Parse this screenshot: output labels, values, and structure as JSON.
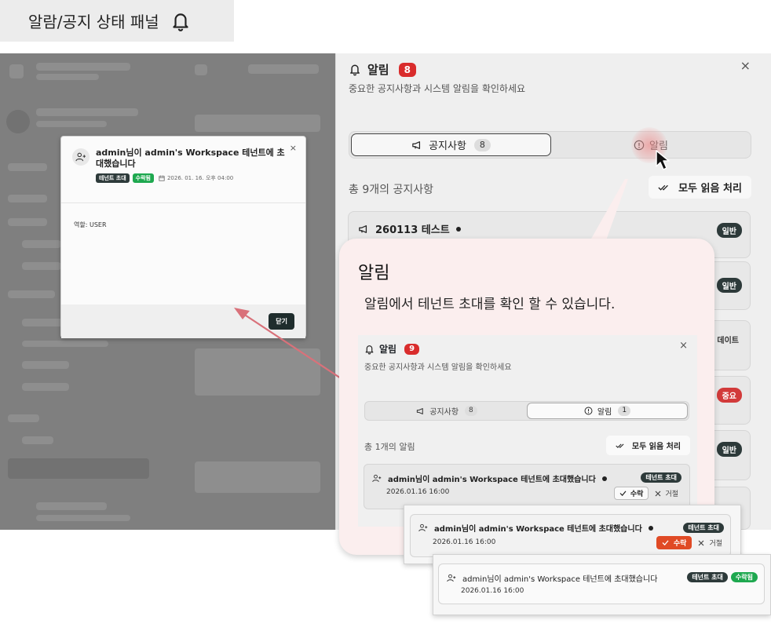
{
  "page_label": {
    "text": "알람/공지 상태 패널"
  },
  "panel": {
    "title": "알림",
    "badge": "8",
    "close": "×",
    "subtitle": "중요한 공지사항과 시스템 알림을 확인하세요",
    "tabs": [
      {
        "label": "공지사항",
        "count": "8"
      },
      {
        "label": "알림"
      }
    ],
    "total": "총 9개의 공지사항",
    "mark_all": "모두 읽음 처리",
    "notices": [
      {
        "title": "260113 테스트",
        "tag": "일반"
      },
      {
        "tag": "일반"
      },
      {
        "partial": "데이트"
      },
      {
        "tag": "중요"
      },
      {
        "tag": "일반"
      }
    ]
  },
  "modal": {
    "title": "admin님이 admin's Workspace 테넌트에 초대했습니다",
    "close": "×",
    "tag_type": "테넌트 초대",
    "tag_status": "수락됨",
    "date": "2026. 01. 16. 오후 04:00",
    "body": "역할: USER",
    "button": "닫기"
  },
  "callout": {
    "title": "알림",
    "description": "알림에서 테넌트 초대를 확인 할 수 있습니다.",
    "mini": {
      "title": "알림",
      "badge": "9",
      "close": "×",
      "subtitle": "중요한 공지사항과 시스템 알림을 확인하세요",
      "tabs": [
        {
          "label": "공지사항",
          "count": "8"
        },
        {
          "label": "알림",
          "count": "1"
        }
      ],
      "total": "총 1개의 알림",
      "mark_all": "모두 읽음 처리",
      "item": {
        "title": "admin님이 admin's Workspace 테넌트에 초대했습니다",
        "date": "2026.01.16 16:00",
        "tag": "테넌트 초대",
        "accept": "수락",
        "reject": "거절"
      }
    }
  },
  "zoom_pending": {
    "title": "admin님이 admin's Workspace 테넌트에 초대했습니다",
    "date": "2026.01.16 16:00",
    "tag": "테넌트 초대",
    "accept": "수락",
    "reject": "거절"
  },
  "zoom_accepted": {
    "title": "admin님이 admin's Workspace 테넌트에 초대했습니다",
    "date": "2026.01.16 16:00",
    "tag": "테넌트 초대",
    "status": "수락됨"
  },
  "colors": {
    "badge_red": "#d92c2c",
    "accept_red": "#e04a25",
    "accepted_green": "#1ea84f",
    "tag_dark": "#2d3a3a",
    "arrow": "#d9717a",
    "callout_bg": "#fbeeee"
  }
}
